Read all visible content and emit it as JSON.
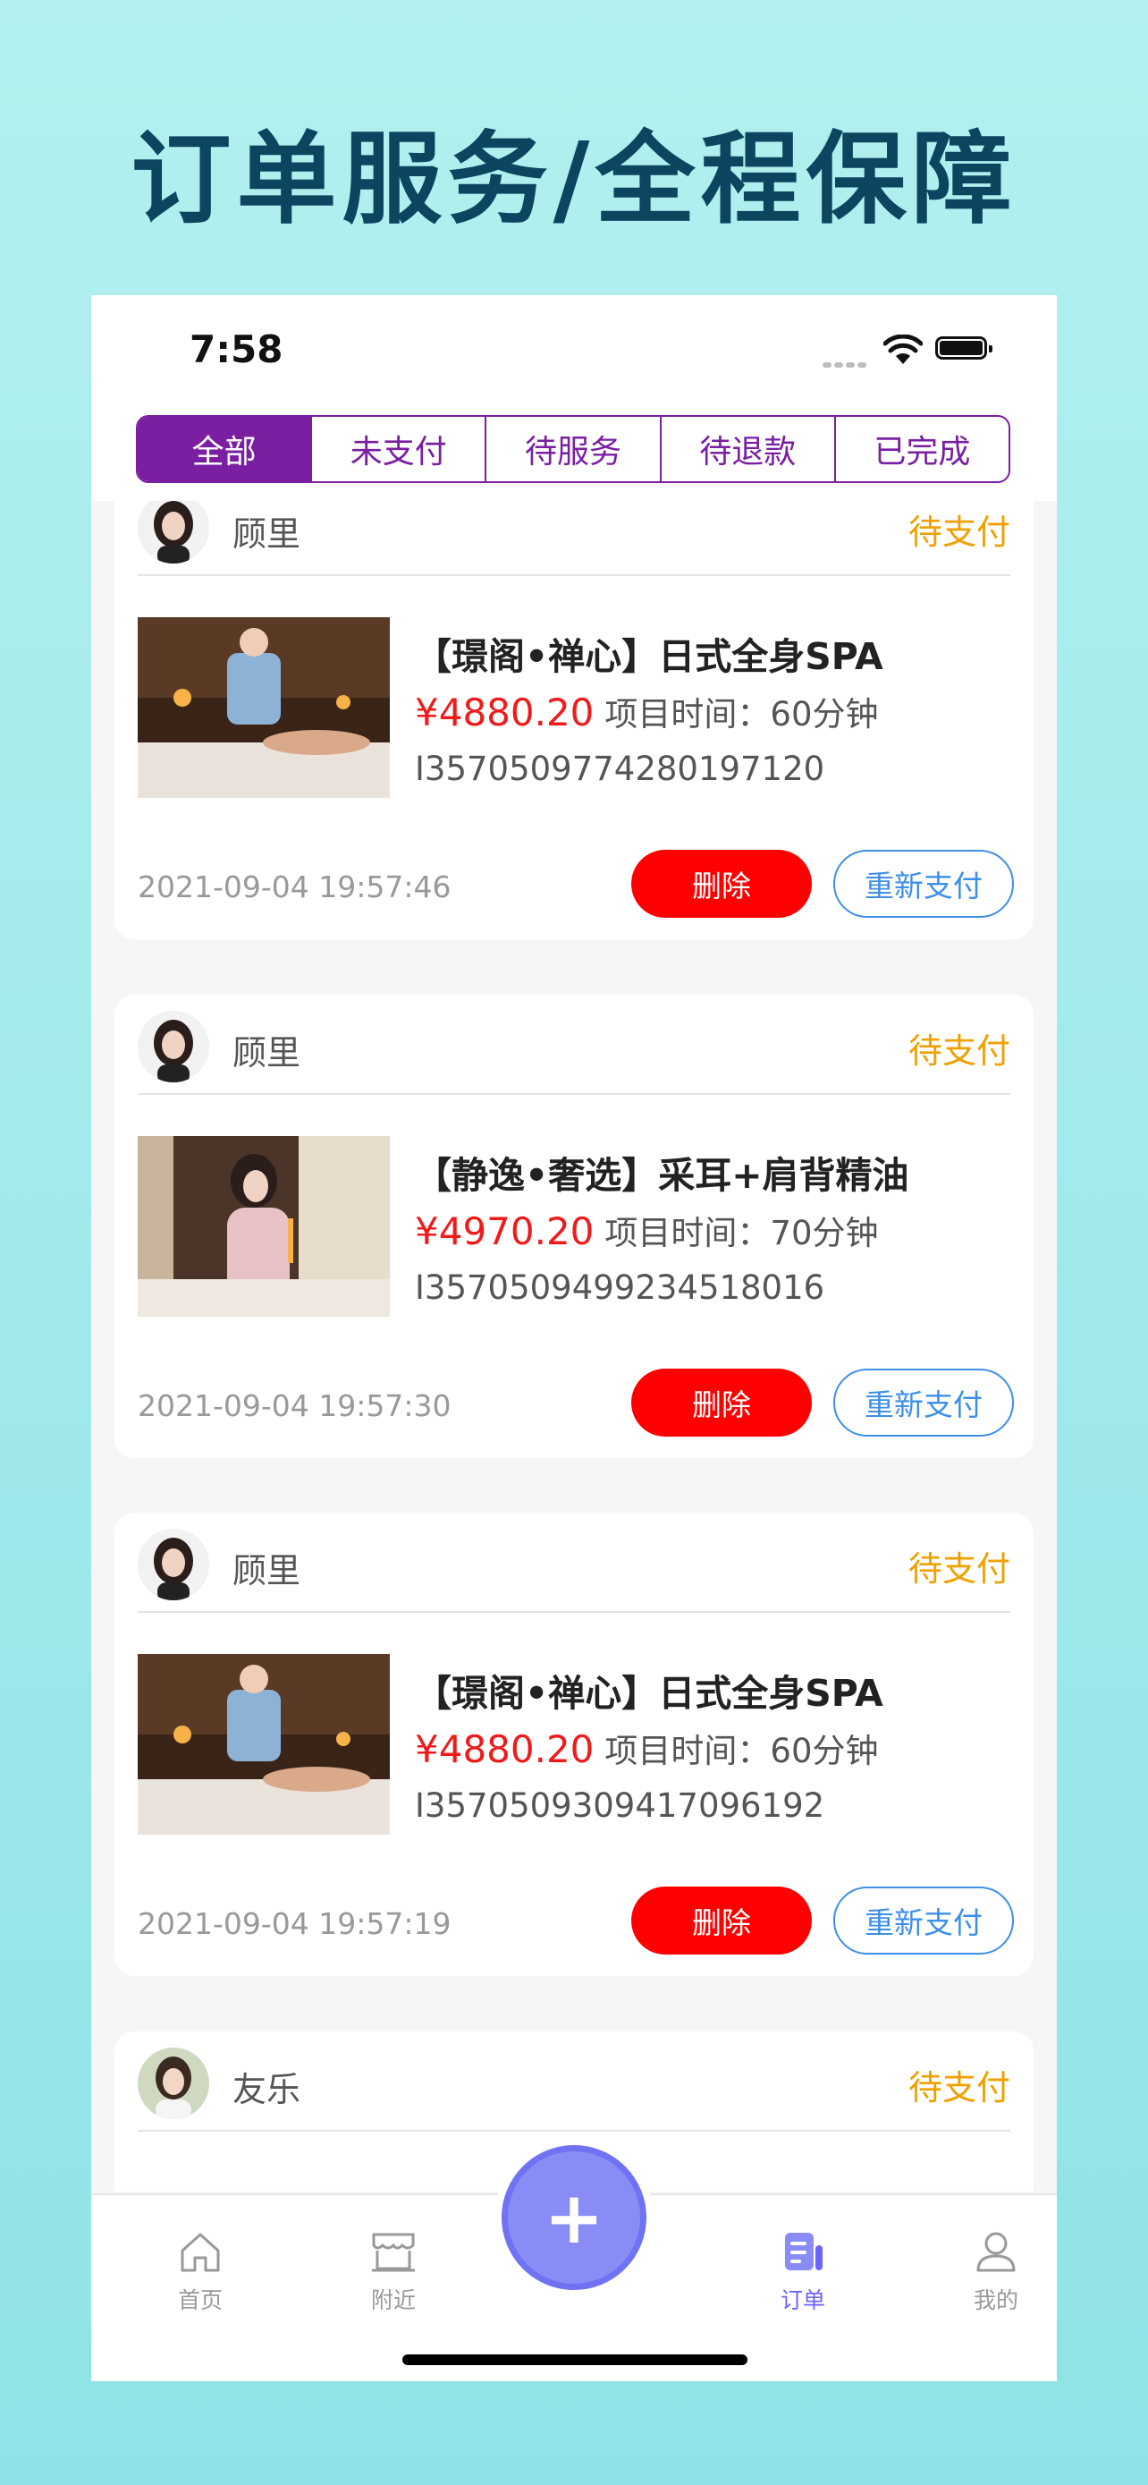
{
  "promo": {
    "title": "订单服务/全程保障"
  },
  "status_bar": {
    "time": "7:58"
  },
  "tabs": [
    {
      "label": "全部",
      "active": true
    },
    {
      "label": "未支付",
      "active": false
    },
    {
      "label": "待服务",
      "active": false
    },
    {
      "label": "待退款",
      "active": false
    },
    {
      "label": "已完成",
      "active": false
    }
  ],
  "orders": [
    {
      "therapist": "顾里",
      "status": "待支付",
      "title": "【璟阁•禅心】日式全身SPA",
      "price": "¥4880.20",
      "duration": "项目时间：60分钟",
      "order_no": "I3570509774280197120",
      "time": "2021-09-04 19:57:46",
      "delete_label": "删除",
      "repay_label": "重新支付"
    },
    {
      "therapist": "顾里",
      "status": "待支付",
      "title": "【静逸•奢选】采耳+肩背精油",
      "price": "¥4970.20",
      "duration": "项目时间：70分钟",
      "order_no": "I3570509499234518016",
      "time": "2021-09-04 19:57:30",
      "delete_label": "删除",
      "repay_label": "重新支付"
    },
    {
      "therapist": "顾里",
      "status": "待支付",
      "title": "【璟阁•禅心】日式全身SPA",
      "price": "¥4880.20",
      "duration": "项目时间：60分钟",
      "order_no": "I3570509309417096192",
      "time": "2021-09-04 19:57:19",
      "delete_label": "删除",
      "repay_label": "重新支付"
    },
    {
      "therapist": "友乐",
      "status": "待支付"
    }
  ],
  "tabbar": {
    "home": "首页",
    "nearby": "附近",
    "add_icon": "plus-icon",
    "orders": "订单",
    "mine": "我的"
  },
  "colors": {
    "accent": "#7a1fa2",
    "price": "#ef1b1b",
    "pending": "#f0a000",
    "tab_active": "#6c63ff"
  }
}
